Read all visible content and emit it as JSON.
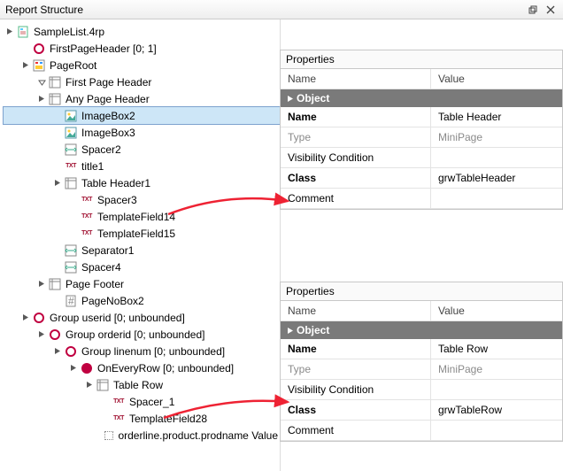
{
  "pane_title": "Report Structure",
  "tree": {
    "root": "SampleList.4rp",
    "fph": "FirstPageHeader [0; 1]",
    "pageroot": "PageRoot",
    "first_page_header": "First Page Header",
    "any_page_header": "Any Page Header",
    "imagebox2": "ImageBox2",
    "imagebox3": "ImageBox3",
    "spacer2": "Spacer2",
    "title1": "title1",
    "table_header1": "Table Header1",
    "spacer3": "Spacer3",
    "tf14": "TemplateField14",
    "tf15": "TemplateField15",
    "separator1": "Separator1",
    "spacer4": "Spacer4",
    "page_footer": "Page Footer",
    "pagenobox2": "PageNoBox2",
    "group_userid": "Group userid [0; unbounded]",
    "group_orderid": "Group orderid [0; unbounded]",
    "group_linenum": "Group linenum [0; unbounded]",
    "oneveryrow": "OnEveryRow [0; unbounded]",
    "table_row": "Table Row",
    "spacer_1": "Spacer_1",
    "tf28": "TemplateField28",
    "prodname": "orderline.product.prodname Value"
  },
  "props1": {
    "title": "Properties",
    "col_name": "Name",
    "col_value": "Value",
    "group": "Object",
    "rows": {
      "name_k": "Name",
      "name_v": "Table Header",
      "type_k": "Type",
      "type_v": "MiniPage",
      "vis_k": "Visibility Condition",
      "vis_v": "",
      "class_k": "Class",
      "class_v": "grwTableHeader",
      "comment_k": "Comment",
      "comment_v": ""
    }
  },
  "props2": {
    "title": "Properties",
    "col_name": "Name",
    "col_value": "Value",
    "group": "Object",
    "rows": {
      "name_k": "Name",
      "name_v": "Table Row",
      "type_k": "Type",
      "type_v": "MiniPage",
      "vis_k": "Visibility Condition",
      "vis_v": "",
      "class_k": "Class",
      "class_v": "grwTableRow",
      "comment_k": "Comment",
      "comment_v": ""
    }
  }
}
